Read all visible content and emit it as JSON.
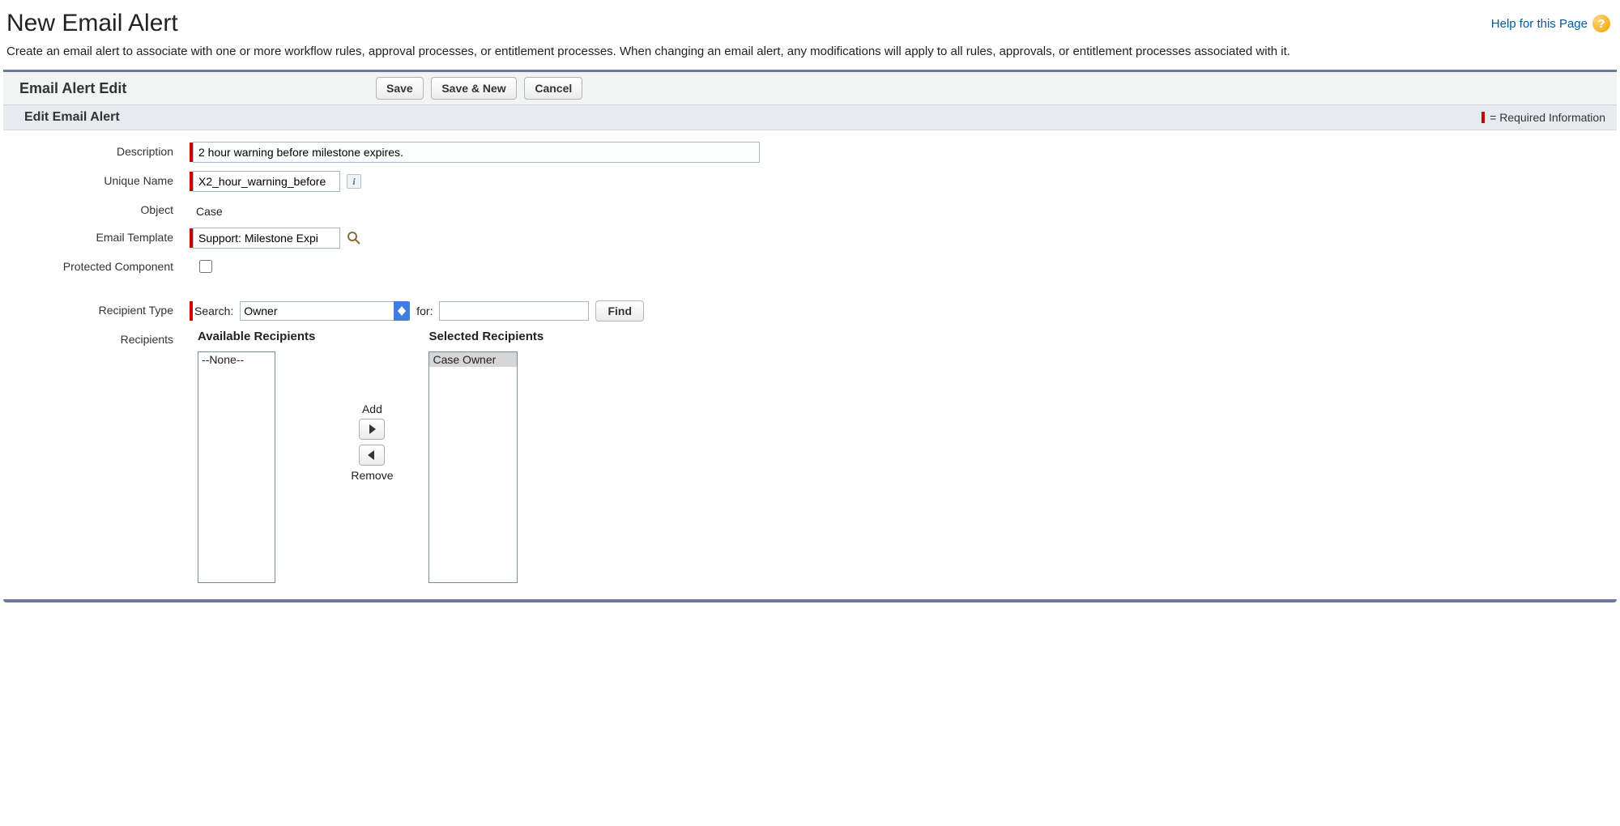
{
  "header": {
    "title": "New Email Alert",
    "help_link": "Help for this Page"
  },
  "intro": "Create an email alert to associate with one or more workflow rules, approval processes, or entitlement processes. When changing an email alert, any modifications will apply to all rules, approvals, or entitlement processes associated with it.",
  "panel": {
    "title": "Email Alert Edit",
    "buttons": {
      "save": "Save",
      "save_new": "Save & New",
      "cancel": "Cancel"
    }
  },
  "section": {
    "title": "Edit Email Alert",
    "required_legend": "= Required Information"
  },
  "form": {
    "description": {
      "label": "Description",
      "value": "2 hour warning before milestone expires."
    },
    "unique_name": {
      "label": "Unique Name",
      "value": "X2_hour_warning_before"
    },
    "object": {
      "label": "Object",
      "value": "Case"
    },
    "email_template": {
      "label": "Email Template",
      "value": "Support: Milestone Expi"
    },
    "protected_component": {
      "label": "Protected Component"
    },
    "recipient_type": {
      "label": "Recipient Type",
      "search_label": "Search:",
      "select_value": "Owner",
      "for_label": "for:",
      "for_value": "",
      "find": "Find"
    },
    "recipients": {
      "label": "Recipients",
      "available_title": "Available Recipients",
      "selected_title": "Selected Recipients",
      "available": [
        "--None--"
      ],
      "selected": [
        "Case Owner"
      ],
      "add_label": "Add",
      "remove_label": "Remove"
    }
  }
}
